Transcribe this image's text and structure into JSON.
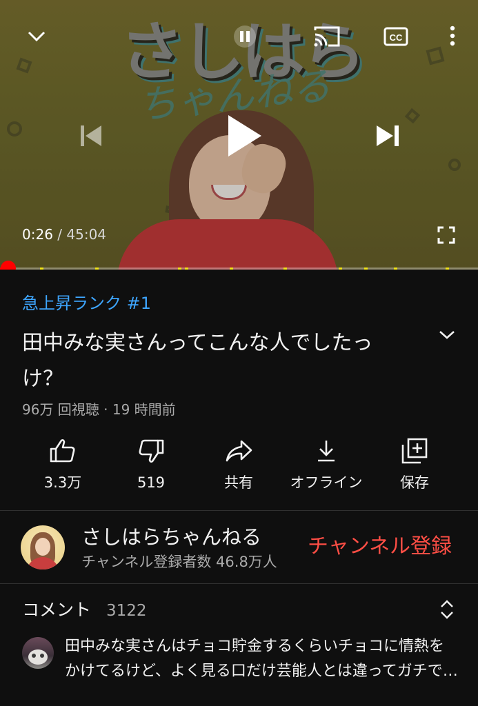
{
  "player": {
    "current_time": "0:26",
    "separator": " / ",
    "duration": "45:04",
    "progress_fraction": 0.0096,
    "thumbnail_title": "さしはら",
    "thumbnail_subtitle": "ちゃんねる",
    "icons": [
      "chevron-down-icon",
      "pause-icon",
      "cast-icon",
      "cc-icon",
      "more-vert-icon",
      "skip-previous-icon",
      "play-icon",
      "skip-next-icon",
      "fullscreen-icon"
    ]
  },
  "video": {
    "trending": "急上昇ランク #1",
    "title": "田中みな実さんってこんな人でしたっけ？",
    "meta": "96万 回視聴 · 19 時間前"
  },
  "actions": [
    {
      "icon": "thumb-up-icon",
      "label": "3.3万"
    },
    {
      "icon": "thumb-down-icon",
      "label": "519"
    },
    {
      "icon": "share-icon",
      "label": "共有"
    },
    {
      "icon": "download-icon",
      "label": "オフライン"
    },
    {
      "icon": "add-to-playlist-icon",
      "label": "保存"
    }
  ],
  "channel": {
    "name": "さしはらちゃんねる",
    "subscribers": "チャンネル登録者数 46.8万人",
    "subscribe_label": "チャンネル登録"
  },
  "comments": {
    "title": "コメント",
    "count": "3122",
    "first_comment": "田中みな実さんはチョコ貯金するくらいチョコに情熱をかけてるけど、よく見る口だけ芸能人とは違ってガチで好きなんだなと思いました。"
  },
  "colors": {
    "background": "#0f0f0f",
    "trending": "#3ea6ff",
    "subscribe": "#ff4e45",
    "progress": "#ff0000",
    "ad_marker": "#f2e51a"
  }
}
